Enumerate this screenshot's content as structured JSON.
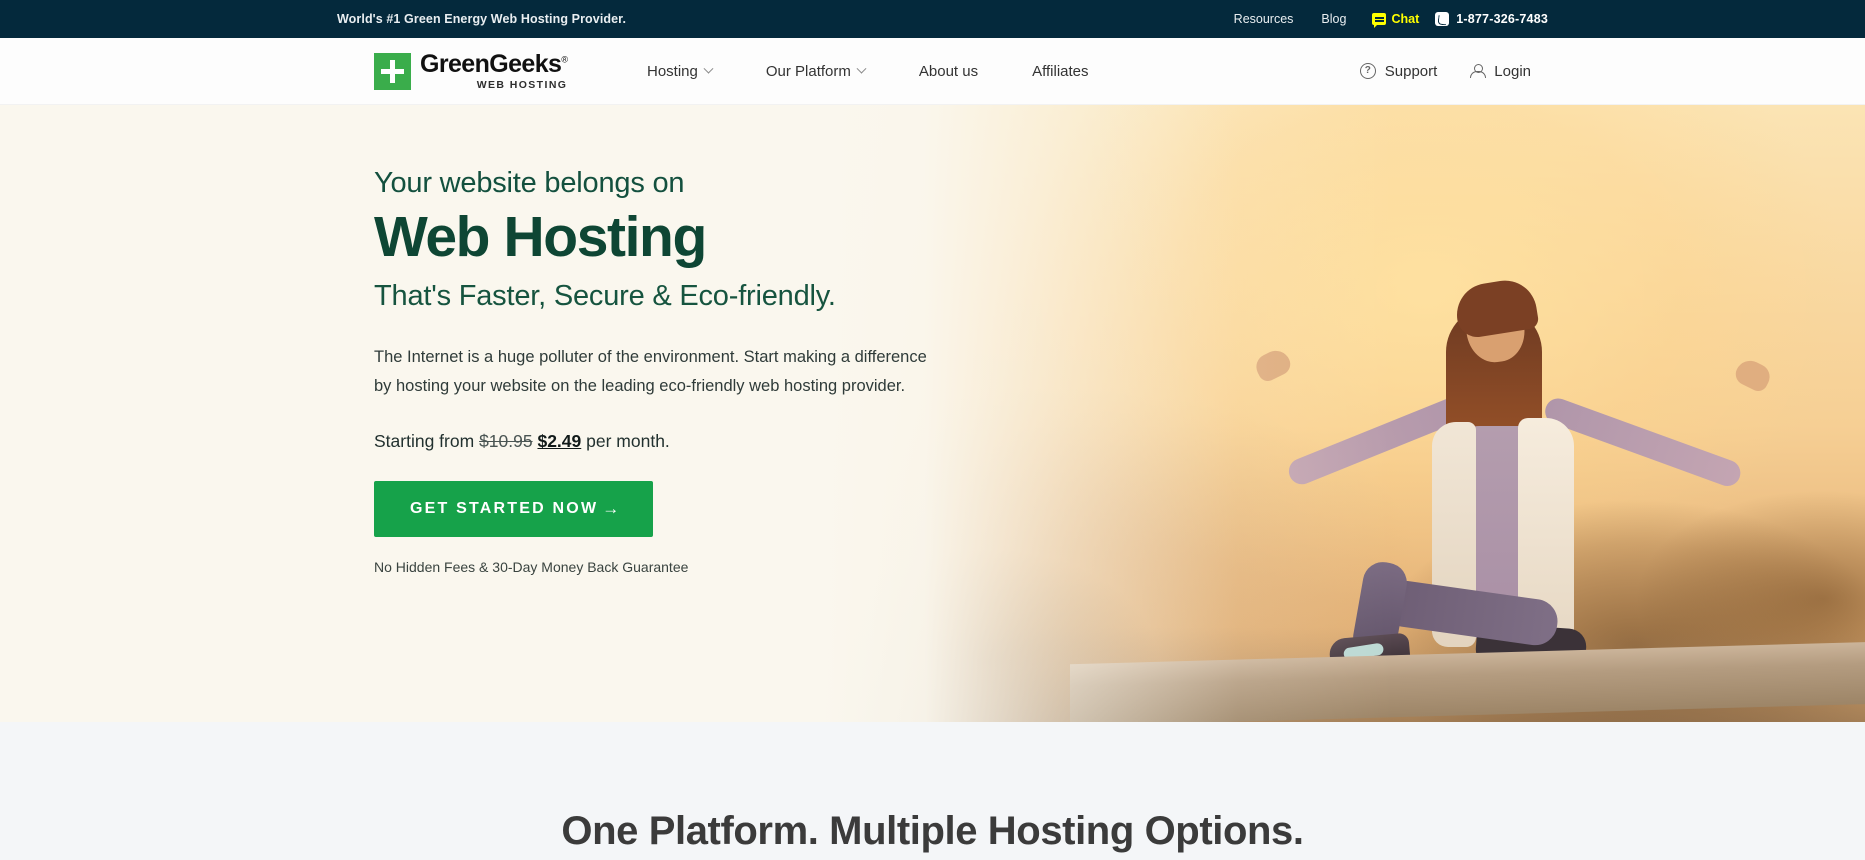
{
  "topbar": {
    "tagline": "World's #1 Green Energy Web Hosting Provider.",
    "links": [
      {
        "label": "Resources"
      },
      {
        "label": "Blog"
      }
    ],
    "chat_label": "Chat",
    "chat_icon": "chat-bubble-icon",
    "phone_icon": "phone-icon",
    "phone": "1-877-326-7483",
    "bg_color": "#04293c",
    "chat_color": "#ffff00"
  },
  "header": {
    "logo": {
      "mark_icon": "plus-icon",
      "word": "GreenGeeks",
      "registered": "®",
      "subtitle": "WEB HOSTING",
      "mark_color": "#3aad4b"
    },
    "nav": [
      {
        "label": "Hosting",
        "has_dropdown": true
      },
      {
        "label": "Our Platform",
        "has_dropdown": true
      },
      {
        "label": "About us",
        "has_dropdown": false
      },
      {
        "label": "Affiliates",
        "has_dropdown": false
      }
    ],
    "support_label": "Support",
    "support_icon": "question-circle-icon",
    "login_label": "Login",
    "login_icon": "user-icon"
  },
  "hero": {
    "kicker": "Your website belongs on",
    "title": "Web Hosting",
    "subtitle": "That's Faster, Secure & Eco-friendly.",
    "description": "The Internet is a huge polluter of the environment. Start making a difference by hosting your website on the leading eco-friendly web hosting provider.",
    "price_prefix": "Starting from",
    "price_old": "$10.95",
    "price_new": "$2.49",
    "price_suffix": "per month.",
    "cta_label": "GET STARTED NOW",
    "cta_arrow": "→",
    "cta_color": "#16a24a",
    "note": "No Hidden Fees & 30-Day Money Back Guarantee",
    "heading_color": "#0e4634",
    "image_alt": "Woman sitting on a stone ledge at sunset with arms outstretched"
  },
  "section": {
    "title": "One Platform. Multiple Hosting Options.",
    "bg_color": "#f4f6f8"
  }
}
